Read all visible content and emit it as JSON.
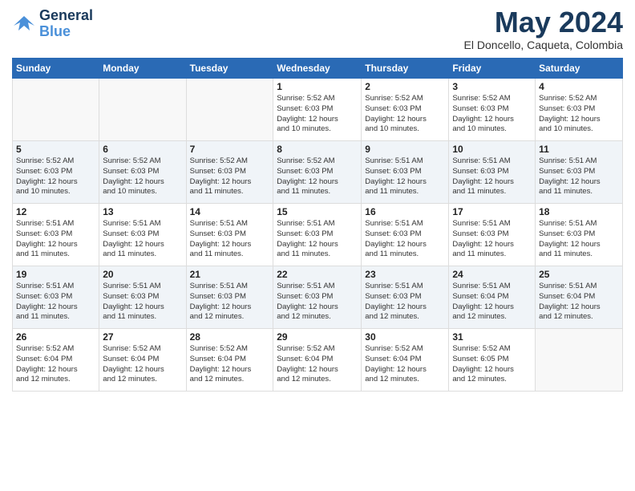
{
  "header": {
    "logo_line1": "General",
    "logo_line2": "Blue",
    "month": "May 2024",
    "location": "El Doncello, Caqueta, Colombia"
  },
  "weekdays": [
    "Sunday",
    "Monday",
    "Tuesday",
    "Wednesday",
    "Thursday",
    "Friday",
    "Saturday"
  ],
  "weeks": [
    [
      {
        "day": "",
        "info": ""
      },
      {
        "day": "",
        "info": ""
      },
      {
        "day": "",
        "info": ""
      },
      {
        "day": "1",
        "info": "Sunrise: 5:52 AM\nSunset: 6:03 PM\nDaylight: 12 hours\nand 10 minutes."
      },
      {
        "day": "2",
        "info": "Sunrise: 5:52 AM\nSunset: 6:03 PM\nDaylight: 12 hours\nand 10 minutes."
      },
      {
        "day": "3",
        "info": "Sunrise: 5:52 AM\nSunset: 6:03 PM\nDaylight: 12 hours\nand 10 minutes."
      },
      {
        "day": "4",
        "info": "Sunrise: 5:52 AM\nSunset: 6:03 PM\nDaylight: 12 hours\nand 10 minutes."
      }
    ],
    [
      {
        "day": "5",
        "info": "Sunrise: 5:52 AM\nSunset: 6:03 PM\nDaylight: 12 hours\nand 10 minutes."
      },
      {
        "day": "6",
        "info": "Sunrise: 5:52 AM\nSunset: 6:03 PM\nDaylight: 12 hours\nand 10 minutes."
      },
      {
        "day": "7",
        "info": "Sunrise: 5:52 AM\nSunset: 6:03 PM\nDaylight: 12 hours\nand 11 minutes."
      },
      {
        "day": "8",
        "info": "Sunrise: 5:52 AM\nSunset: 6:03 PM\nDaylight: 12 hours\nand 11 minutes."
      },
      {
        "day": "9",
        "info": "Sunrise: 5:51 AM\nSunset: 6:03 PM\nDaylight: 12 hours\nand 11 minutes."
      },
      {
        "day": "10",
        "info": "Sunrise: 5:51 AM\nSunset: 6:03 PM\nDaylight: 12 hours\nand 11 minutes."
      },
      {
        "day": "11",
        "info": "Sunrise: 5:51 AM\nSunset: 6:03 PM\nDaylight: 12 hours\nand 11 minutes."
      }
    ],
    [
      {
        "day": "12",
        "info": "Sunrise: 5:51 AM\nSunset: 6:03 PM\nDaylight: 12 hours\nand 11 minutes."
      },
      {
        "day": "13",
        "info": "Sunrise: 5:51 AM\nSunset: 6:03 PM\nDaylight: 12 hours\nand 11 minutes."
      },
      {
        "day": "14",
        "info": "Sunrise: 5:51 AM\nSunset: 6:03 PM\nDaylight: 12 hours\nand 11 minutes."
      },
      {
        "day": "15",
        "info": "Sunrise: 5:51 AM\nSunset: 6:03 PM\nDaylight: 12 hours\nand 11 minutes."
      },
      {
        "day": "16",
        "info": "Sunrise: 5:51 AM\nSunset: 6:03 PM\nDaylight: 12 hours\nand 11 minutes."
      },
      {
        "day": "17",
        "info": "Sunrise: 5:51 AM\nSunset: 6:03 PM\nDaylight: 12 hours\nand 11 minutes."
      },
      {
        "day": "18",
        "info": "Sunrise: 5:51 AM\nSunset: 6:03 PM\nDaylight: 12 hours\nand 11 minutes."
      }
    ],
    [
      {
        "day": "19",
        "info": "Sunrise: 5:51 AM\nSunset: 6:03 PM\nDaylight: 12 hours\nand 11 minutes."
      },
      {
        "day": "20",
        "info": "Sunrise: 5:51 AM\nSunset: 6:03 PM\nDaylight: 12 hours\nand 11 minutes."
      },
      {
        "day": "21",
        "info": "Sunrise: 5:51 AM\nSunset: 6:03 PM\nDaylight: 12 hours\nand 12 minutes."
      },
      {
        "day": "22",
        "info": "Sunrise: 5:51 AM\nSunset: 6:03 PM\nDaylight: 12 hours\nand 12 minutes."
      },
      {
        "day": "23",
        "info": "Sunrise: 5:51 AM\nSunset: 6:03 PM\nDaylight: 12 hours\nand 12 minutes."
      },
      {
        "day": "24",
        "info": "Sunrise: 5:51 AM\nSunset: 6:04 PM\nDaylight: 12 hours\nand 12 minutes."
      },
      {
        "day": "25",
        "info": "Sunrise: 5:51 AM\nSunset: 6:04 PM\nDaylight: 12 hours\nand 12 minutes."
      }
    ],
    [
      {
        "day": "26",
        "info": "Sunrise: 5:52 AM\nSunset: 6:04 PM\nDaylight: 12 hours\nand 12 minutes."
      },
      {
        "day": "27",
        "info": "Sunrise: 5:52 AM\nSunset: 6:04 PM\nDaylight: 12 hours\nand 12 minutes."
      },
      {
        "day": "28",
        "info": "Sunrise: 5:52 AM\nSunset: 6:04 PM\nDaylight: 12 hours\nand 12 minutes."
      },
      {
        "day": "29",
        "info": "Sunrise: 5:52 AM\nSunset: 6:04 PM\nDaylight: 12 hours\nand 12 minutes."
      },
      {
        "day": "30",
        "info": "Sunrise: 5:52 AM\nSunset: 6:04 PM\nDaylight: 12 hours\nand 12 minutes."
      },
      {
        "day": "31",
        "info": "Sunrise: 5:52 AM\nSunset: 6:05 PM\nDaylight: 12 hours\nand 12 minutes."
      },
      {
        "day": "",
        "info": ""
      }
    ]
  ]
}
